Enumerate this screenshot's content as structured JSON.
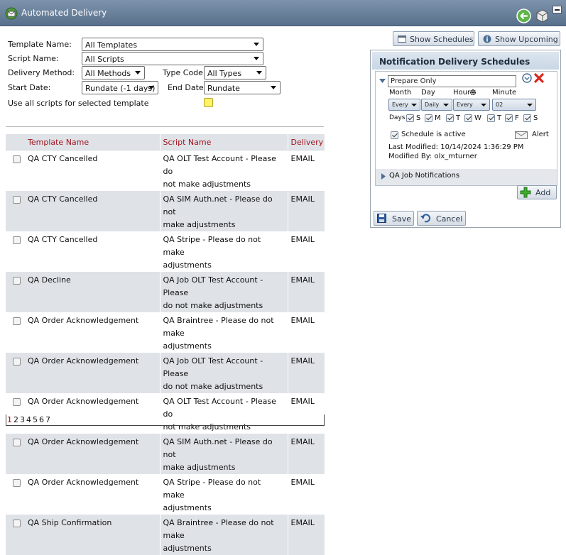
{
  "window": {
    "title": "Automated Delivery"
  },
  "form": {
    "template_name_label": "Template Name:",
    "template_name_value": "All Templates",
    "script_name_label": "Script Name:",
    "script_name_value": "All Scripts",
    "delivery_method_label": "Delivery Method:",
    "delivery_method_value": "All Methods",
    "type_code_label": "Type Code:",
    "type_code_value": "All Types",
    "start_date_label": "Start Date:",
    "start_date_value": "Rundate (-1 days)",
    "end_date_label": "End Date:",
    "end_date_value": "Rundate",
    "use_all_scripts_label": "Use all scripts for selected template"
  },
  "table": {
    "headers": [
      "Template Name",
      "Script Name",
      "Delivery"
    ],
    "rows": [
      {
        "template": "QA CTY Cancelled",
        "script1": "QA OLT Test Account - Please do",
        "script2": "not make adjustments",
        "delivery": "EMAIL"
      },
      {
        "template": "QA CTY Cancelled",
        "script1": "QA SIM Auth.net - Please do not",
        "script2": "make adjustments",
        "delivery": "EMAIL"
      },
      {
        "template": "QA CTY Cancelled",
        "script1": "QA Stripe - Please do not make",
        "script2": "adjustments",
        "delivery": "EMAIL"
      },
      {
        "template": "QA Decline",
        "script1": "QA Job OLT Test Account - Please",
        "script2": "do not make adjustments",
        "delivery": "EMAIL"
      },
      {
        "template": "QA Order Acknowledgement",
        "script1": "QA Braintree - Please do not make",
        "script2": "adjustments",
        "delivery": "EMAIL"
      },
      {
        "template": "QA Order Acknowledgement",
        "script1": "QA Job OLT Test Account - Please",
        "script2": "do not make adjustments",
        "delivery": "EMAIL"
      },
      {
        "template": "QA Order Acknowledgement",
        "script1": "QA OLT Test Account - Please do",
        "script2": "not make adjustments",
        "delivery": "EMAIL"
      },
      {
        "template": "QA Order Acknowledgement",
        "script1": "QA SIM Auth.net - Please do not",
        "script2": "make adjustments",
        "delivery": "EMAIL"
      },
      {
        "template": "QA Order Acknowledgement",
        "script1": "QA Stripe - Please do not make",
        "script2": "adjustments",
        "delivery": "EMAIL"
      },
      {
        "template": "QA Ship Confirmation",
        "script1": "QA Braintree - Please do not make",
        "script2": "adjustments",
        "delivery": "EMAIL"
      }
    ]
  },
  "pager": {
    "pages": [
      "1",
      "2",
      "3",
      "4",
      "5",
      "6",
      "7"
    ],
    "current": "1"
  },
  "buttons": {
    "show_schedules": "Show Schedules",
    "show_upcoming": "Show Upcoming",
    "add": "Add",
    "save": "Save",
    "cancel": "Cancel"
  },
  "panel": {
    "title": "Notification Delivery Schedules",
    "schedule_name": "Prepare Only",
    "month_label": "Month",
    "day_label": "Day",
    "hour_label": "Hour",
    "minute_label": "Minute",
    "month_value": "Every",
    "day_value": "Daily",
    "hour_value": "Every",
    "minute_value": "02",
    "days_label": "Days",
    "days": [
      "S",
      "M",
      "T",
      "W",
      "T",
      "F",
      "S"
    ],
    "active_label": "Schedule is active",
    "alert_label": "Alert",
    "last_modified": "Last Modified: 10/14/2024 1:36:29 PM",
    "modified_by": "Modified By: olx_mturner",
    "job_notifications": "QA Job Notifications"
  },
  "colors": {
    "titlebar": "#6b8099",
    "header_text": "#a0141e",
    "alt_row": "#dfe3e8",
    "highlight_checkbox": "#fff36a",
    "add_icon": "#3cae2c",
    "delete_icon": "#d9261c"
  }
}
